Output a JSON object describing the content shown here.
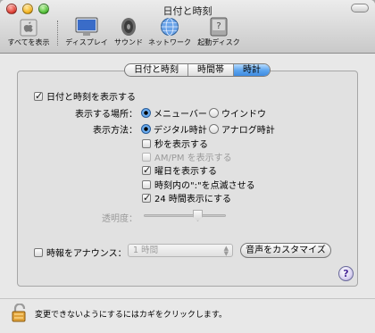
{
  "window": {
    "title": "日付と時刻"
  },
  "toolbar": {
    "show_all": "すべてを表示",
    "display": "ディスプレイ",
    "sound": "サウンド",
    "network": "ネットワーク",
    "startup_disk": "起動ディスク"
  },
  "tabs": [
    {
      "label": "日付と時刻",
      "active": false
    },
    {
      "label": "時間帯",
      "active": false
    },
    {
      "label": "時計",
      "active": true
    }
  ],
  "clock": {
    "show_datetime": {
      "label": "日付と時刻を表示する",
      "checked": true
    },
    "location": {
      "label": "表示する場所：",
      "options": [
        "メニューバー",
        "ウインドウ"
      ],
      "selected": "メニューバー"
    },
    "format": {
      "label": "表示方法：",
      "options": [
        "デジタル時計",
        "アナログ時計"
      ],
      "selected": "デジタル時計"
    },
    "show_seconds": {
      "label": "秒を表示する",
      "checked": false
    },
    "show_ampm": {
      "label": "AM/PM を表示する",
      "checked": false,
      "enabled": false
    },
    "show_weekday": {
      "label": "曜日を表示する",
      "checked": true
    },
    "flash_separators": {
      "label": "時刻内の\":\"を点滅させる",
      "checked": false
    },
    "use_24h": {
      "label": "24 時間表示にする",
      "checked": true
    },
    "transparency": {
      "label": "透明度："
    },
    "announce": {
      "label": "時報をアナウンス：",
      "checked": false,
      "interval": "1 時間",
      "customize_button": "音声をカスタマイズ"
    }
  },
  "footer": {
    "lock_text": "変更できないようにするにはカギをクリックします。"
  },
  "help": {
    "label": "?"
  },
  "colors": {
    "accent": "#3f8be0",
    "panel": "#e1e1e1"
  }
}
